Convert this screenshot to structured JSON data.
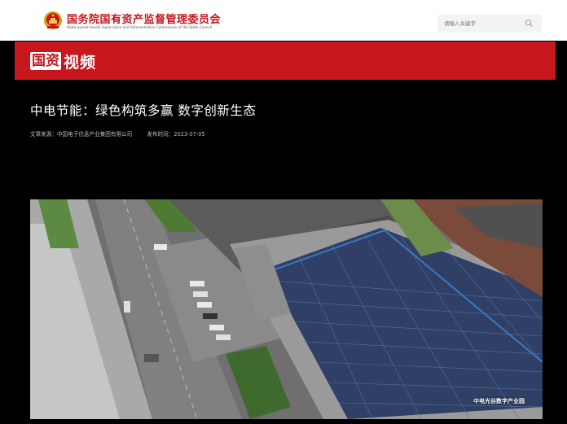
{
  "header": {
    "org_name_zh": "国务院国有资产监督管理委员会",
    "org_name_en": "State-owned Assets Supervision and Administration Commission of the State Council",
    "emblem_icon": "national-emblem-icon",
    "search": {
      "placeholder": "请输入关键字",
      "icon": "search-icon"
    }
  },
  "banner": {
    "brand_box": "国资",
    "brand_text": "视频",
    "color": "#c8161d"
  },
  "article": {
    "title": "中电节能：绿色构筑多赢 数字创新生态",
    "source": "文章来源：中国电子信息产业集团有限公司",
    "date": "发布时间：2023-07-05"
  },
  "media": {
    "caption": "中电光谷数字产业园"
  }
}
